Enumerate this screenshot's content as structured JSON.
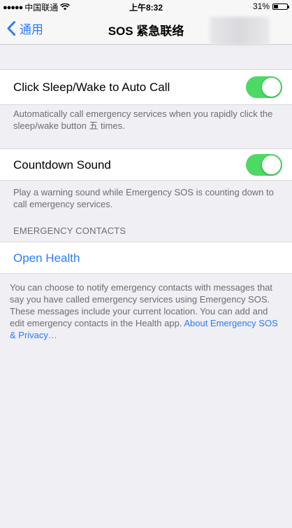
{
  "status_bar": {
    "carrier": "中国联通",
    "time": "上午8:32",
    "battery_percent": "31%",
    "battery_level": 0.31,
    "signal_icon": "signal-dots-icon",
    "wifi_icon": "wifi-icon"
  },
  "nav": {
    "back_label": "通用",
    "title": "SOS 紧急联络"
  },
  "auto_call": {
    "label": "Click Sleep/Wake to Auto Call",
    "enabled": true,
    "footer": "Automatically call emergency services when you rapidly click the sleep/wake button 五 times."
  },
  "countdown": {
    "label": "Countdown Sound",
    "enabled": true,
    "footer": "Play a warning sound while Emergency SOS is counting down to call emergency services."
  },
  "contacts": {
    "header": "EMERGENCY CONTACTS",
    "open_health": "Open Health",
    "footer": "You can choose to notify emergency contacts with messages that say you have called emergency services using Emergency SOS. These messages include your current location. You can add and edit emergency contacts in the Health app.",
    "privacy_link": "About Emergency SOS & Privacy…"
  },
  "colors": {
    "accent": "#2b7cf6",
    "toggle_on": "#4cd964",
    "background": "#efeff4"
  }
}
